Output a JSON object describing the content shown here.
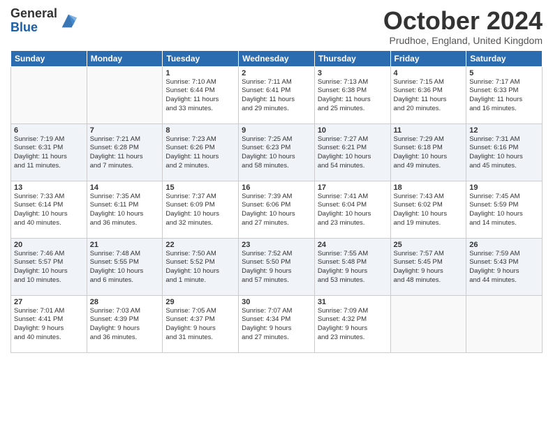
{
  "header": {
    "logo_line1": "General",
    "logo_line2": "Blue",
    "month_title": "October 2024",
    "subtitle": "Prudhoe, England, United Kingdom"
  },
  "days": [
    "Sunday",
    "Monday",
    "Tuesday",
    "Wednesday",
    "Thursday",
    "Friday",
    "Saturday"
  ],
  "weeks": [
    [
      {
        "num": "",
        "lines": []
      },
      {
        "num": "",
        "lines": []
      },
      {
        "num": "1",
        "lines": [
          "Sunrise: 7:10 AM",
          "Sunset: 6:44 PM",
          "Daylight: 11 hours",
          "and 33 minutes."
        ]
      },
      {
        "num": "2",
        "lines": [
          "Sunrise: 7:11 AM",
          "Sunset: 6:41 PM",
          "Daylight: 11 hours",
          "and 29 minutes."
        ]
      },
      {
        "num": "3",
        "lines": [
          "Sunrise: 7:13 AM",
          "Sunset: 6:38 PM",
          "Daylight: 11 hours",
          "and 25 minutes."
        ]
      },
      {
        "num": "4",
        "lines": [
          "Sunrise: 7:15 AM",
          "Sunset: 6:36 PM",
          "Daylight: 11 hours",
          "and 20 minutes."
        ]
      },
      {
        "num": "5",
        "lines": [
          "Sunrise: 7:17 AM",
          "Sunset: 6:33 PM",
          "Daylight: 11 hours",
          "and 16 minutes."
        ]
      }
    ],
    [
      {
        "num": "6",
        "lines": [
          "Sunrise: 7:19 AM",
          "Sunset: 6:31 PM",
          "Daylight: 11 hours",
          "and 11 minutes."
        ]
      },
      {
        "num": "7",
        "lines": [
          "Sunrise: 7:21 AM",
          "Sunset: 6:28 PM",
          "Daylight: 11 hours",
          "and 7 minutes."
        ]
      },
      {
        "num": "8",
        "lines": [
          "Sunrise: 7:23 AM",
          "Sunset: 6:26 PM",
          "Daylight: 11 hours",
          "and 2 minutes."
        ]
      },
      {
        "num": "9",
        "lines": [
          "Sunrise: 7:25 AM",
          "Sunset: 6:23 PM",
          "Daylight: 10 hours",
          "and 58 minutes."
        ]
      },
      {
        "num": "10",
        "lines": [
          "Sunrise: 7:27 AM",
          "Sunset: 6:21 PM",
          "Daylight: 10 hours",
          "and 54 minutes."
        ]
      },
      {
        "num": "11",
        "lines": [
          "Sunrise: 7:29 AM",
          "Sunset: 6:18 PM",
          "Daylight: 10 hours",
          "and 49 minutes."
        ]
      },
      {
        "num": "12",
        "lines": [
          "Sunrise: 7:31 AM",
          "Sunset: 6:16 PM",
          "Daylight: 10 hours",
          "and 45 minutes."
        ]
      }
    ],
    [
      {
        "num": "13",
        "lines": [
          "Sunrise: 7:33 AM",
          "Sunset: 6:14 PM",
          "Daylight: 10 hours",
          "and 40 minutes."
        ]
      },
      {
        "num": "14",
        "lines": [
          "Sunrise: 7:35 AM",
          "Sunset: 6:11 PM",
          "Daylight: 10 hours",
          "and 36 minutes."
        ]
      },
      {
        "num": "15",
        "lines": [
          "Sunrise: 7:37 AM",
          "Sunset: 6:09 PM",
          "Daylight: 10 hours",
          "and 32 minutes."
        ]
      },
      {
        "num": "16",
        "lines": [
          "Sunrise: 7:39 AM",
          "Sunset: 6:06 PM",
          "Daylight: 10 hours",
          "and 27 minutes."
        ]
      },
      {
        "num": "17",
        "lines": [
          "Sunrise: 7:41 AM",
          "Sunset: 6:04 PM",
          "Daylight: 10 hours",
          "and 23 minutes."
        ]
      },
      {
        "num": "18",
        "lines": [
          "Sunrise: 7:43 AM",
          "Sunset: 6:02 PM",
          "Daylight: 10 hours",
          "and 19 minutes."
        ]
      },
      {
        "num": "19",
        "lines": [
          "Sunrise: 7:45 AM",
          "Sunset: 5:59 PM",
          "Daylight: 10 hours",
          "and 14 minutes."
        ]
      }
    ],
    [
      {
        "num": "20",
        "lines": [
          "Sunrise: 7:46 AM",
          "Sunset: 5:57 PM",
          "Daylight: 10 hours",
          "and 10 minutes."
        ]
      },
      {
        "num": "21",
        "lines": [
          "Sunrise: 7:48 AM",
          "Sunset: 5:55 PM",
          "Daylight: 10 hours",
          "and 6 minutes."
        ]
      },
      {
        "num": "22",
        "lines": [
          "Sunrise: 7:50 AM",
          "Sunset: 5:52 PM",
          "Daylight: 10 hours",
          "and 1 minute."
        ]
      },
      {
        "num": "23",
        "lines": [
          "Sunrise: 7:52 AM",
          "Sunset: 5:50 PM",
          "Daylight: 9 hours",
          "and 57 minutes."
        ]
      },
      {
        "num": "24",
        "lines": [
          "Sunrise: 7:55 AM",
          "Sunset: 5:48 PM",
          "Daylight: 9 hours",
          "and 53 minutes."
        ]
      },
      {
        "num": "25",
        "lines": [
          "Sunrise: 7:57 AM",
          "Sunset: 5:45 PM",
          "Daylight: 9 hours",
          "and 48 minutes."
        ]
      },
      {
        "num": "26",
        "lines": [
          "Sunrise: 7:59 AM",
          "Sunset: 5:43 PM",
          "Daylight: 9 hours",
          "and 44 minutes."
        ]
      }
    ],
    [
      {
        "num": "27",
        "lines": [
          "Sunrise: 7:01 AM",
          "Sunset: 4:41 PM",
          "Daylight: 9 hours",
          "and 40 minutes."
        ]
      },
      {
        "num": "28",
        "lines": [
          "Sunrise: 7:03 AM",
          "Sunset: 4:39 PM",
          "Daylight: 9 hours",
          "and 36 minutes."
        ]
      },
      {
        "num": "29",
        "lines": [
          "Sunrise: 7:05 AM",
          "Sunset: 4:37 PM",
          "Daylight: 9 hours",
          "and 31 minutes."
        ]
      },
      {
        "num": "30",
        "lines": [
          "Sunrise: 7:07 AM",
          "Sunset: 4:34 PM",
          "Daylight: 9 hours",
          "and 27 minutes."
        ]
      },
      {
        "num": "31",
        "lines": [
          "Sunrise: 7:09 AM",
          "Sunset: 4:32 PM",
          "Daylight: 9 hours",
          "and 23 minutes."
        ]
      },
      {
        "num": "",
        "lines": []
      },
      {
        "num": "",
        "lines": []
      }
    ]
  ]
}
